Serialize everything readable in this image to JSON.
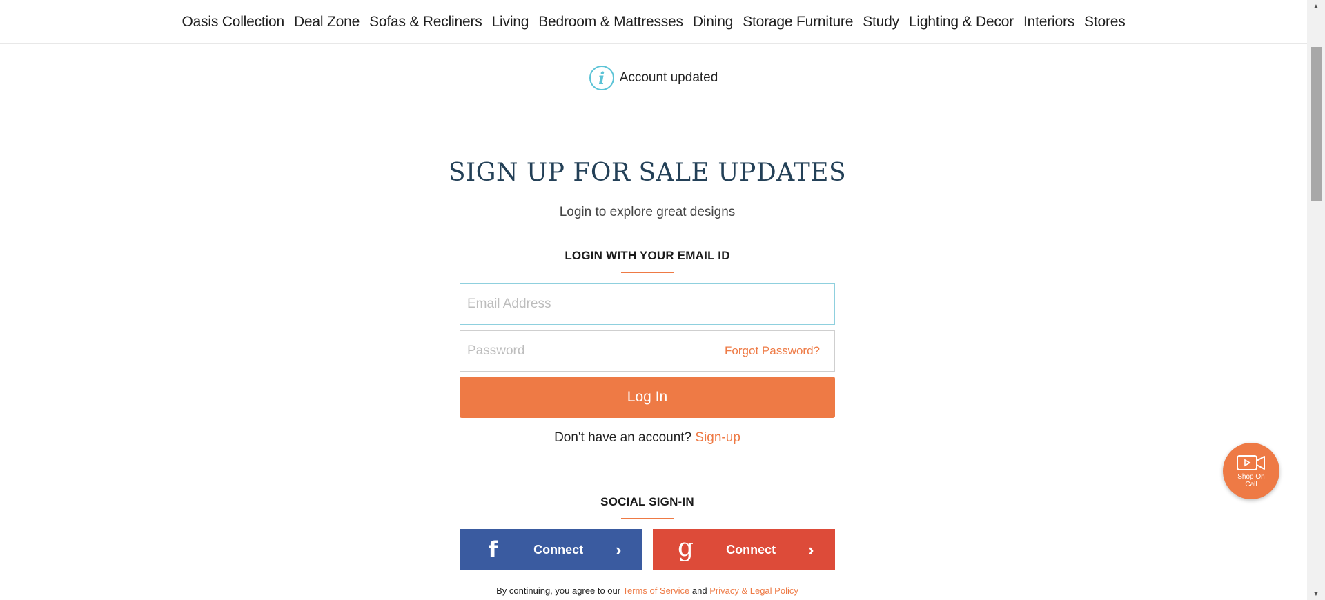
{
  "nav": {
    "items": [
      {
        "label": "Oasis Collection"
      },
      {
        "label": "Deal Zone"
      },
      {
        "label": "Sofas & Recliners"
      },
      {
        "label": "Living"
      },
      {
        "label": "Bedroom & Mattresses"
      },
      {
        "label": "Dining"
      },
      {
        "label": "Storage Furniture"
      },
      {
        "label": "Study"
      },
      {
        "label": "Lighting & Decor"
      },
      {
        "label": "Interiors"
      },
      {
        "label": "Stores"
      }
    ]
  },
  "alert": {
    "icon": "info-icon",
    "icon_glyph": "i",
    "text": "Account updated"
  },
  "login": {
    "headline": "SIGN UP FOR SALE UPDATES",
    "subhead": "Login to explore great designs",
    "email_section_label": "LOGIN WITH YOUR EMAIL ID",
    "email_placeholder": "Email Address",
    "email_value": "",
    "password_placeholder": "Password",
    "password_value": "",
    "forgot_label": "Forgot Password?",
    "login_button_label": "Log In",
    "no_account_text": "Don't have an account?",
    "signup_link_label": "Sign-up"
  },
  "social": {
    "section_label": "SOCIAL SIGN-IN",
    "facebook": {
      "icon": "facebook-icon",
      "glyph": "f",
      "label": "Connect",
      "chevron": "›"
    },
    "google": {
      "icon": "google-icon",
      "glyph": "g",
      "label": "Connect",
      "chevron": "›"
    }
  },
  "terms": {
    "prefix": "By continuing, you agree to our",
    "terms_link": "Terms of Service",
    "and": "and",
    "privacy_link": "Privacy & Legal Policy"
  },
  "fab": {
    "icon": "video-camera-icon",
    "label": "Shop On Call"
  },
  "colors": {
    "accent": "#ee7a45",
    "headline": "#234057",
    "info": "#5bc3d6",
    "facebook": "#3a5ba0",
    "google": "#dd4b39"
  }
}
